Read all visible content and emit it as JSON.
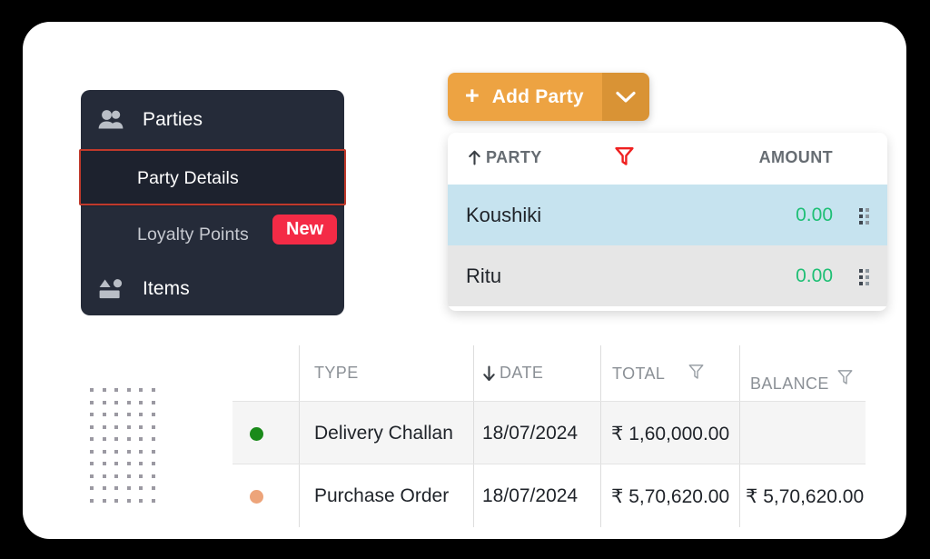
{
  "sidebar": {
    "items": [
      {
        "label": "Parties",
        "icon": "people-icon",
        "type": "group"
      },
      {
        "label": "Party Details",
        "icon": "none",
        "type": "sub",
        "selected": true
      },
      {
        "label": "Loyalty Points",
        "icon": "none",
        "type": "sub",
        "badge": "New"
      },
      {
        "label": "Items",
        "icon": "shapes-icon",
        "type": "group"
      }
    ],
    "badge_new": "New",
    "highlight_color": "#c0392b",
    "background_color": "#252b39",
    "selected_background": "#1d222e",
    "badge_color": "#f42b46"
  },
  "add_party": {
    "plus": "+",
    "label": "Add Party",
    "caret_icon": "chevron-down-icon",
    "color": "#eda342",
    "caret_color": "#d99335"
  },
  "party_table": {
    "columns": [
      {
        "label": "PARTY",
        "sort_icon": "arrow-up-icon"
      },
      {
        "label": "AMOUNT",
        "sort_icon": "none"
      }
    ],
    "filter_icon": "filter-icon",
    "filter_color": "#ef2020",
    "amount_color": "#1fbf75",
    "selected_row_color": "#c6e3ef",
    "rows": [
      {
        "party": "Koushiki",
        "amount": "0.00",
        "selected": true,
        "handle": "drag-handle-icon"
      },
      {
        "party": "Ritu",
        "amount": "0.00",
        "selected": false,
        "handle": "drag-handle-icon"
      }
    ]
  },
  "txn_table": {
    "columns": [
      {
        "label": "TYPE",
        "sort_icon": "none",
        "filter_icon": "none"
      },
      {
        "label": "DATE",
        "sort_icon": "arrow-down-icon",
        "filter_icon": "none"
      },
      {
        "label": "TOTAL",
        "sort_icon": "none",
        "filter_icon": "filter-icon"
      },
      {
        "label": "BALANCE",
        "sort_icon": "none",
        "filter_icon": "filter-icon"
      }
    ],
    "rows": [
      {
        "status_color": "#1a8a1a",
        "type": "Delivery Challan",
        "date": "18/07/2024",
        "total": "₹ 1,60,000.00",
        "balance": ""
      },
      {
        "status_color": "#eda47a",
        "type": "Purchase Order",
        "date": "18/07/2024",
        "total": "₹ 5,70,620.00",
        "balance": "₹ 5,70,620.00"
      }
    ]
  },
  "decor": {
    "dot_grid_columns": 6,
    "dot_grid_rows": 10,
    "dot_color": "#9b99a2"
  }
}
